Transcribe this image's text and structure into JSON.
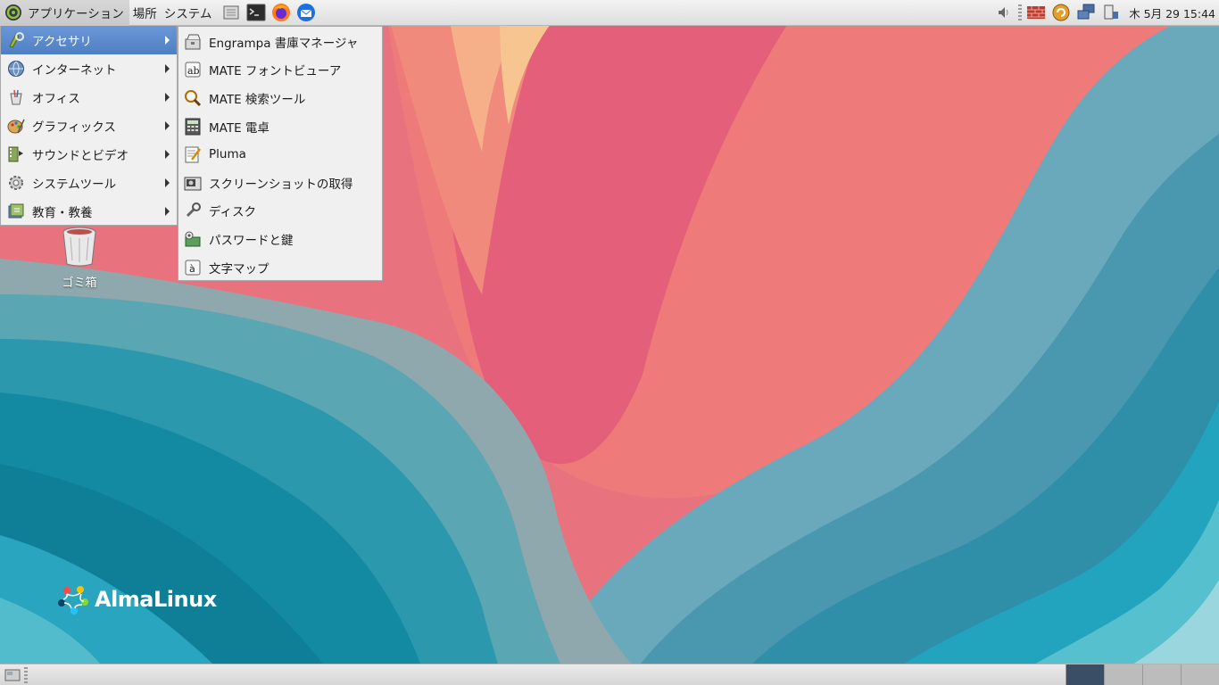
{
  "top_panel": {
    "menus": [
      "アプリケーション",
      "場所",
      "システム"
    ],
    "launchers": [
      "terminal-icon",
      "firefox-icon",
      "thunderbird-icon"
    ],
    "tray_icons": [
      "volume-icon",
      "firewall-icon",
      "update-icon",
      "network-icon",
      "removable-media-icon"
    ],
    "clock": "木 5月 29 15:44"
  },
  "app_menu": {
    "items": [
      {
        "label": "アクセサリ",
        "icon": "accessories-icon",
        "active": true
      },
      {
        "label": "インターネット",
        "icon": "internet-icon"
      },
      {
        "label": "オフィス",
        "icon": "office-icon"
      },
      {
        "label": "グラフィックス",
        "icon": "graphics-icon"
      },
      {
        "label": "サウンドとビデオ",
        "icon": "sound-video-icon"
      },
      {
        "label": "システムツール",
        "icon": "system-tools-icon"
      },
      {
        "label": "教育・教養",
        "icon": "education-icon"
      }
    ]
  },
  "sub_menu": {
    "items": [
      {
        "label": "Engrampa 書庫マネージャ",
        "icon": "archive-manager-icon"
      },
      {
        "label": "MATE フォントビューア",
        "icon": "font-viewer-icon"
      },
      {
        "label": "MATE 検索ツール",
        "icon": "search-tool-icon"
      },
      {
        "label": "MATE 電卓",
        "icon": "calculator-icon"
      },
      {
        "label": "Pluma",
        "icon": "text-editor-icon"
      },
      {
        "label": "スクリーンショットの取得",
        "icon": "screenshot-icon"
      },
      {
        "label": "ディスク",
        "icon": "disks-icon"
      },
      {
        "label": "パスワードと鍵",
        "icon": "passwords-keys-icon"
      },
      {
        "label": "文字マップ",
        "icon": "character-map-icon"
      }
    ]
  },
  "desktop": {
    "trash_label": "ゴミ箱",
    "logo_text": "AlmaLinux"
  },
  "colors": {
    "menu_highlight": "#5a89cc",
    "panel_bg": "#e6e6e6",
    "active_workspace": "#3a4f66"
  }
}
